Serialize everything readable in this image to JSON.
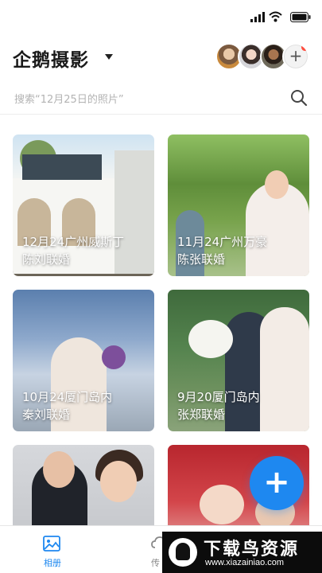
{
  "header": {
    "title": "企鹅摄影",
    "add_member_label": "+"
  },
  "search": {
    "placeholder": "搜索“12月25日的照片”"
  },
  "albums": [
    {
      "line1": "12月24广州威斯丁",
      "line2": "陈刘联婚"
    },
    {
      "line1": "11月24广州万豪",
      "line2": "陈张联婚"
    },
    {
      "line1": "10月24厦门岛内",
      "line2": "秦刘联婚"
    },
    {
      "line1": "9月20厦门岛内",
      "line2": "张郑联婚"
    }
  ],
  "fab": {
    "label": "+"
  },
  "tabs": [
    {
      "label": "相册",
      "icon": "photo-icon",
      "active": true
    },
    {
      "label": "传",
      "icon": "upload-cloud-icon",
      "active": false
    }
  ],
  "watermark": {
    "title": "下载鸟资源",
    "url": "www.xiazainiao.com"
  },
  "colors": {
    "accent": "#1e88f0",
    "badge": "#ff4d3f"
  }
}
